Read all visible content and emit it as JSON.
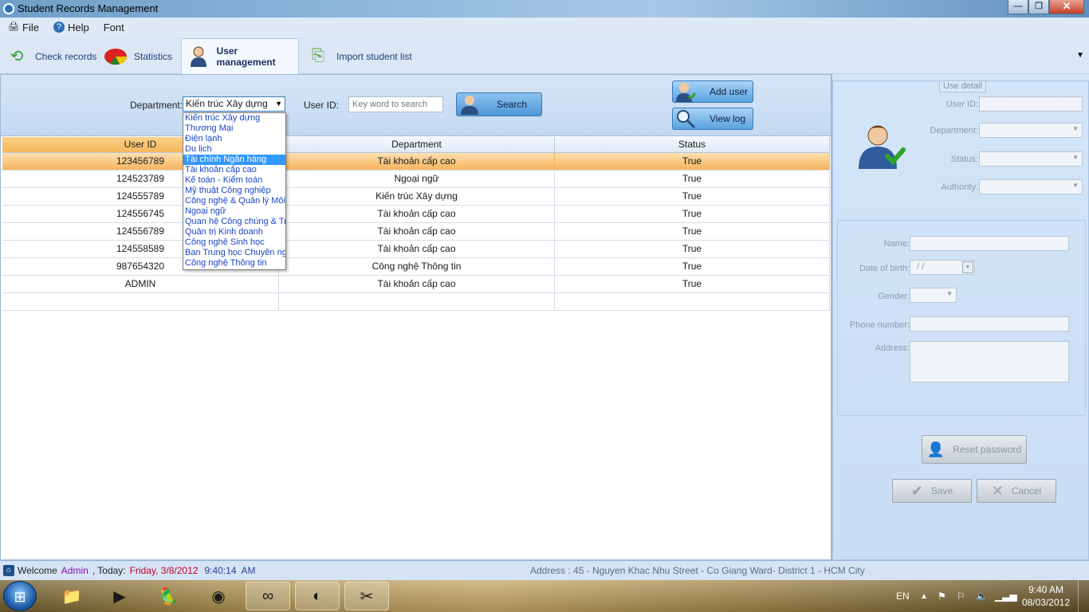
{
  "window": {
    "title": "Student Records Management",
    "controls": {
      "minimize": "—",
      "maximize": "❐",
      "close": "✕"
    }
  },
  "menu": [
    "File",
    "Help",
    "Font"
  ],
  "tabs": [
    {
      "label": "Check records",
      "icon": "back-arrow-icon"
    },
    {
      "label": "Statistics",
      "icon": "pie-chart-icon"
    },
    {
      "label": "User management",
      "icon": "user-icon",
      "active": true
    },
    {
      "label": "Import student list",
      "icon": "import-icon"
    }
  ],
  "search": {
    "department_label": "Department:",
    "department_value": "Kiến trúc Xây dựng",
    "userid_label": "User ID:",
    "userid_placeholder": "Key word to search",
    "search_button": "Search",
    "add_user_button": "Add user",
    "view_log_button": "View log"
  },
  "department_options": [
    "Kiến trúc Xây dựng",
    "Thương Mại",
    "Điện lạnh",
    "Du lịch",
    "Tài chính Ngân hàng",
    "Tài khoản cấp cao",
    "Kế toán - Kiểm toán",
    "Mỹ thuật Công nghiệp",
    "Công nghệ & Quản lý Môi t",
    "Ngoại ngữ",
    "Quan hệ Công chúng & Tr",
    "Quản trị Kinh doanh",
    "Công nghệ Sinh học",
    "Ban Trung học Chuyên ng",
    "Công nghệ Thông tin"
  ],
  "highlighted_option": "Tài chính Ngân hàng",
  "table": {
    "columns": [
      "User ID",
      "Department",
      "Status"
    ],
    "rows": [
      [
        "123456789",
        "Tài khoản cấp cao",
        "True"
      ],
      [
        "124523789",
        "Ngoại ngữ",
        "True"
      ],
      [
        "124555789",
        "Kiến trúc Xây dựng",
        "True"
      ],
      [
        "124556745",
        "Tài khoản cấp cao",
        "True"
      ],
      [
        "124556789",
        "Tài khoản cấp cao",
        "True"
      ],
      [
        "124558589",
        "Tài khoản cấp cao",
        "True"
      ],
      [
        "987654320",
        "Công nghệ Thông tin",
        "True"
      ],
      [
        "ADMIN",
        "Tài khoản cấp cao",
        "True"
      ]
    ],
    "selected_row": "123456789"
  },
  "detail": {
    "legend": "Use detail",
    "labels": {
      "user_id": "User ID:",
      "department": "Department:",
      "status": "Status:",
      "authority": "Authority:",
      "name": "Name:",
      "dob": "Date of birth:",
      "gender": "Gender:",
      "phone": "Phone number:",
      "address": "Address:"
    },
    "dob_value": "/  /",
    "reset_password_button": "Reset password",
    "save_button": "Save",
    "cancel_button": "Cancel"
  },
  "status": {
    "welcome": "Welcome",
    "user": "Admin",
    "today_label": ", Today:",
    "date": "Friday, 3/8/2012",
    "time": "9:40:14",
    "ampm": "AM",
    "address": "Address : 45 - Nguyen Khac Nhu Street - Co Giang Ward- District 1 - HCM City"
  },
  "taskbar": {
    "language": "EN",
    "clock_time": "9:40 AM",
    "clock_date": "08/03/2012"
  },
  "colors": {
    "selected_row": "#f7b35d",
    "dropdown_highlight": "#3399ff",
    "welcome_user": "#8d0fb1",
    "date_red": "#c3002c"
  }
}
